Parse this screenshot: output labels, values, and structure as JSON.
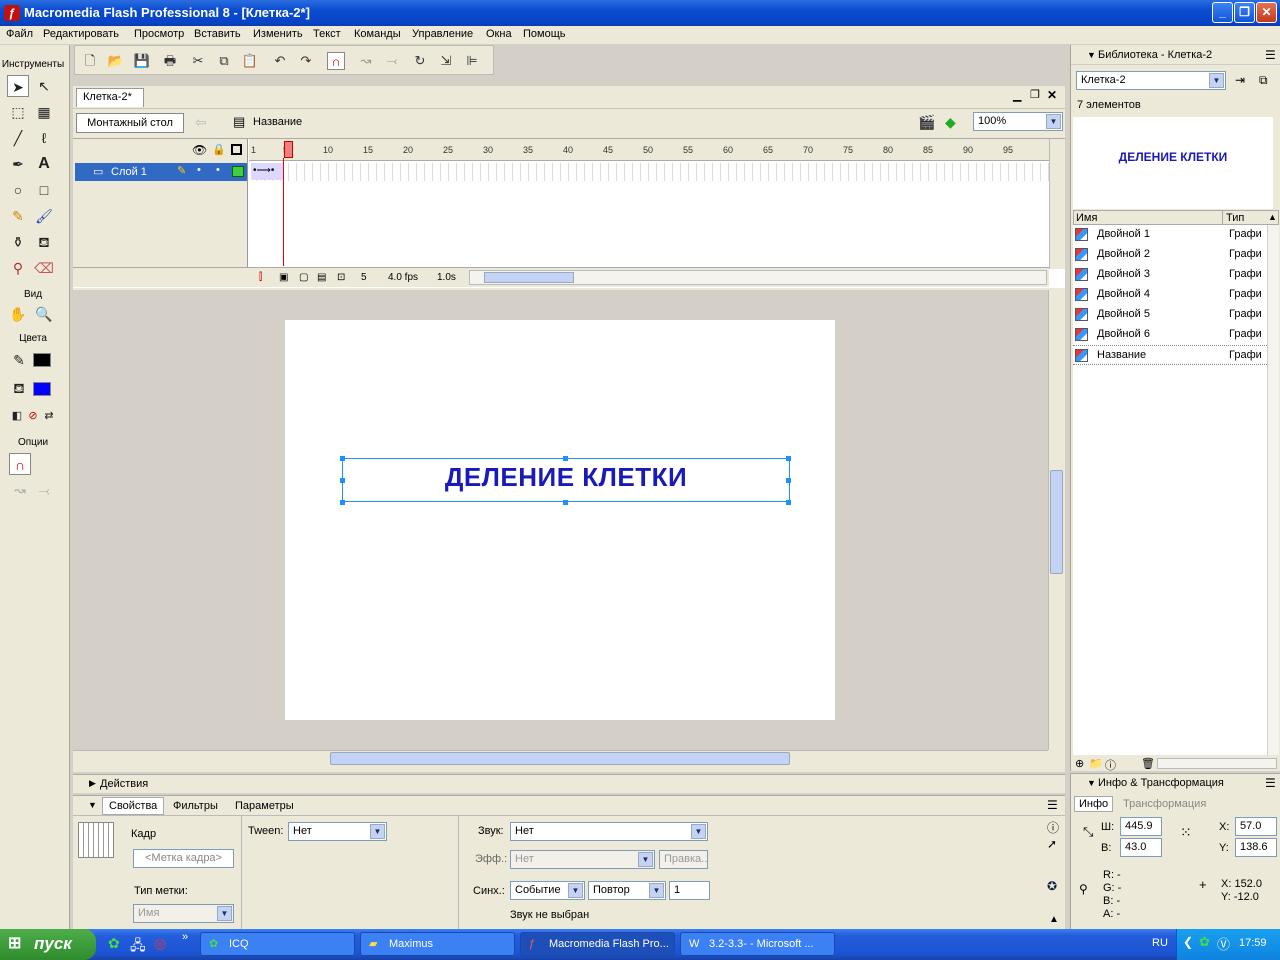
{
  "window": {
    "title": "Macromedia Flash Professional 8 - [Клетка-2*]"
  },
  "menu": [
    "Файл",
    "Редактировать",
    "Просмотр",
    "Вставить",
    "Изменить",
    "Текст",
    "Команды",
    "Управление",
    "Окна",
    "Помощь"
  ],
  "tools": {
    "header": "Инструменты",
    "view_label": "Вид",
    "colors_label": "Цвета",
    "options_label": "Опции"
  },
  "document": {
    "tab": "Клетка-2*",
    "scene_button": "Монтажный стол",
    "symbol_name": "Название",
    "zoom": "100%"
  },
  "timeline": {
    "layer_name": "Слой 1",
    "ruler": [
      "1",
      "5",
      "10",
      "15",
      "20",
      "25",
      "30",
      "35",
      "40",
      "45",
      "50",
      "55",
      "60",
      "65",
      "70",
      "75",
      "80",
      "85",
      "90",
      "95"
    ],
    "current_frame": "5",
    "fps": "4.0 fps",
    "time": "1.0s"
  },
  "stage": {
    "text": "ДЕЛЕНИЕ КЛЕТКИ",
    "text_color": "#1a1ab8"
  },
  "panels": {
    "actions": "Действия",
    "props_tabs": [
      "Свойства",
      "Фильтры",
      "Параметры"
    ],
    "frame_label": "Кадр",
    "frame_label_placeholder": "<Метка кадра>",
    "label_type": "Тип метки:",
    "label_type_value": "Имя",
    "tween_label": "Tween:",
    "tween_value": "Нет",
    "sound_label": "Звук:",
    "sound_value": "Нет",
    "effect_label": "Эфф.:",
    "effect_value": "Нет",
    "edit_button": "Правка...",
    "sync_label": "Синх.:",
    "sync_value": "Событие",
    "repeat_value": "Повтор",
    "repeat_count": "1",
    "no_sound": "Звук не выбран"
  },
  "library": {
    "title": "Библиотека - Клетка-2",
    "doc_select": "Клетка-2",
    "count": "7 элементов",
    "preview_text": "ДЕЛЕНИЕ КЛЕТКИ",
    "col_name": "Имя",
    "col_type": "Тип",
    "items": [
      {
        "name": "Двойной 1",
        "type": "Графи"
      },
      {
        "name": "Двойной 2",
        "type": "Графи"
      },
      {
        "name": "Двойной 3",
        "type": "Графи"
      },
      {
        "name": "Двойной 4",
        "type": "Графи"
      },
      {
        "name": "Двойной 5",
        "type": "Графи"
      },
      {
        "name": "Двойной 6",
        "type": "Графи"
      },
      {
        "name": "Название",
        "type": "Графи"
      }
    ]
  },
  "info": {
    "title": "Инфо & Трансформация",
    "tab_info": "Инфо",
    "tab_transform": "Трансформация",
    "w_label": "Ш:",
    "w": "445.9",
    "h_label": "В:",
    "h": "43.0",
    "x_label": "X:",
    "x": "57.0",
    "y_label": "Y:",
    "y": "138.6",
    "r": "R: -",
    "g": "G: -",
    "b": "B: -",
    "a": "A: -",
    "cx": "X:  152.0",
    "cy": "Y:  -12.0"
  },
  "taskbar": {
    "start": "пуск",
    "tasks": [
      "ICQ",
      "Maximus",
      "Macromedia Flash Pro...",
      "3.2-3.3- - Microsoft ..."
    ],
    "lang": "RU",
    "clock": "17:59"
  }
}
